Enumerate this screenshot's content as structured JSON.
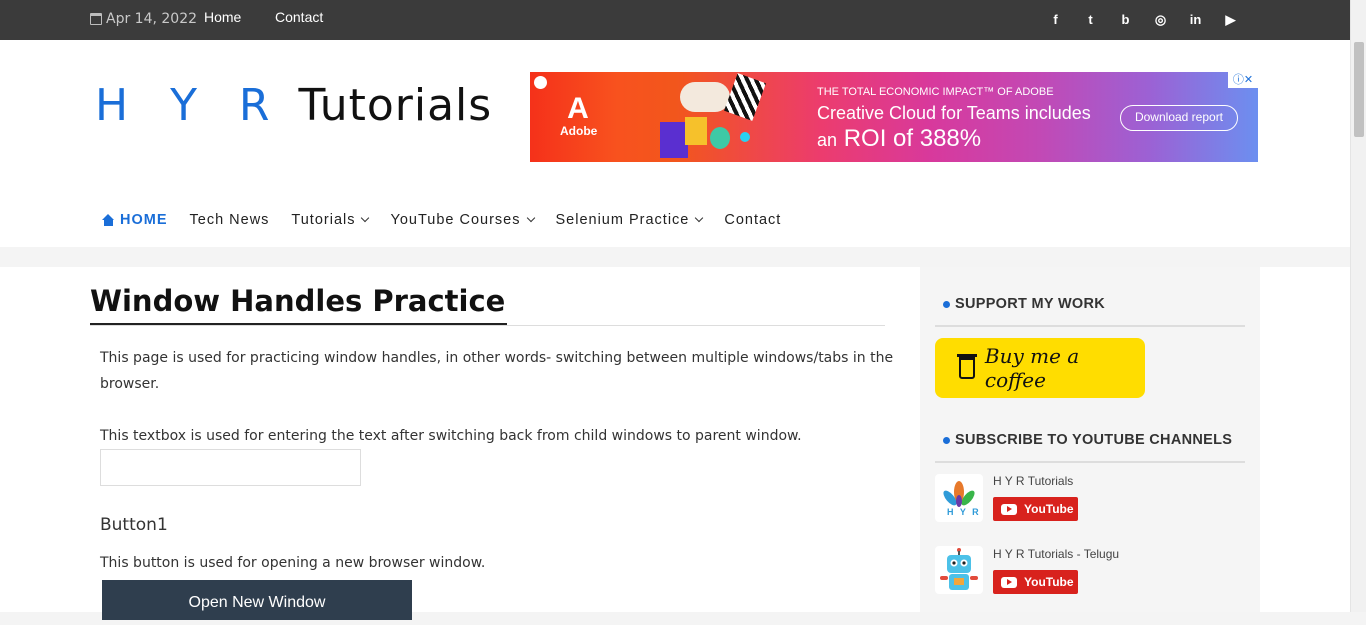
{
  "topbar": {
    "date": "Apr 14, 2022",
    "links": [
      "Home",
      "Contact"
    ],
    "social_icons": [
      "facebook-icon",
      "twitter-icon",
      "blogger-icon",
      "instagram-icon",
      "linkedin-icon",
      "youtube-icon"
    ],
    "social_glyphs": [
      "f",
      "t",
      "b",
      "◎",
      "in",
      "▶"
    ]
  },
  "logo": {
    "part1": "H Y R",
    "part2": "Tutorials"
  },
  "ad": {
    "brand": "Adobe",
    "kicker": "THE TOTAL ECONOMIC IMPACT™ OF ADOBE",
    "headline1": "Creative Cloud for Teams includes",
    "headline2_prefix": "an",
    "headline2_main": "ROI of 388%",
    "cta": "Download report",
    "close": "ⓘ✕"
  },
  "nav": {
    "items": [
      {
        "label": "HOME",
        "active": true,
        "dropdown": false
      },
      {
        "label": "Tech News",
        "active": false,
        "dropdown": false
      },
      {
        "label": "Tutorials",
        "active": false,
        "dropdown": true
      },
      {
        "label": "YouTube Courses",
        "active": false,
        "dropdown": true
      },
      {
        "label": "Selenium Practice",
        "active": false,
        "dropdown": true
      },
      {
        "label": "Contact",
        "active": false,
        "dropdown": false
      }
    ]
  },
  "main": {
    "title": "Window Handles Practice",
    "intro_line1": "This page is used for practicing window handles, in other words- switching between multiple windows/tabs in the",
    "intro_line2": "browser.",
    "textbox_desc": "This textbox is used for entering the text after switching back from child windows to parent window.",
    "textbox_value": "",
    "button1_heading": "Button1",
    "button1_desc": "This button is used for opening a new browser window.",
    "button1_label": "Open New Window"
  },
  "sidebar": {
    "support_heading": "SUPPORT MY WORK",
    "coffee_label": "Buy me a coffee",
    "subscribe_heading": "SUBSCRIBE TO YOUTUBE CHANNELS",
    "channels": [
      {
        "name": "H Y R Tutorials",
        "button": "YouTube",
        "thumb_text": "H Y R"
      },
      {
        "name": "H Y R Tutorials - Telugu",
        "button": "YouTube",
        "thumb_text": ""
      }
    ]
  },
  "colors": {
    "accent": "#1a6ed8",
    "topbar": "#3b3b3b",
    "button_dark": "#2f3e4e",
    "coffee_yellow": "#ffdd00",
    "youtube_red": "#d8221d"
  }
}
